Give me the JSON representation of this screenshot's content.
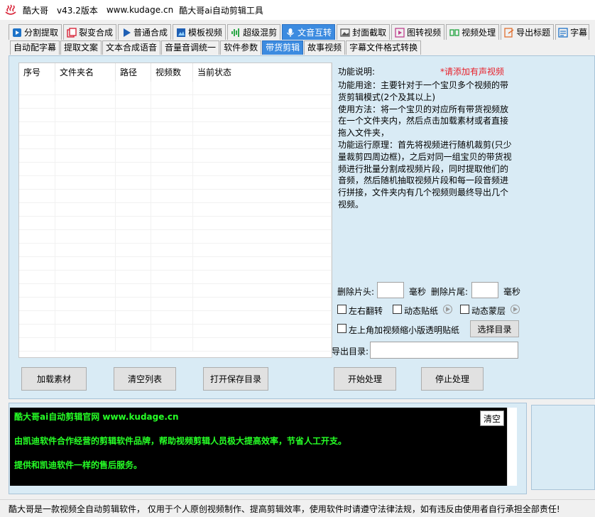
{
  "window": {
    "app_name": "酷大哥",
    "version": "v43.2版本",
    "url": "www.kudage.cn",
    "subtitle": "酷大哥ai自动剪辑工具"
  },
  "main_tabs": [
    {
      "label": "分割提取",
      "icon": "play-square-icon",
      "color": "#1e73c8"
    },
    {
      "label": "裂变合成",
      "icon": "copy-frames-icon",
      "color": "#d9273b"
    },
    {
      "label": "普通合成",
      "icon": "play-triangle-icon",
      "color": "#1e5fb4"
    },
    {
      "label": "模板视频",
      "icon": "template-icon",
      "color": "#1e5fb4"
    },
    {
      "label": "超级混剪",
      "icon": "waveform-icon",
      "color": "#2ea84a"
    },
    {
      "label": "文音互转",
      "icon": "microphone-icon",
      "color": "#ffffff",
      "active": true
    },
    {
      "label": "封面截取",
      "icon": "image-icon",
      "color": "#555555"
    },
    {
      "label": "图转视频",
      "icon": "picture-to-video-icon",
      "color": "#c0408e"
    },
    {
      "label": "视频处理",
      "icon": "video-split-icon",
      "color": "#2ea84a"
    },
    {
      "label": "导出标题",
      "icon": "export-title-icon",
      "color": "#e07030"
    },
    {
      "label": "字幕",
      "icon": "subtitle-icon",
      "color": "#1e73c8"
    }
  ],
  "sub_tabs": [
    {
      "label": "自动配字幕"
    },
    {
      "label": "提取文案"
    },
    {
      "label": "文本合成语音"
    },
    {
      "label": "音量音调统一"
    },
    {
      "label": "软件参数"
    },
    {
      "label": "带货剪辑",
      "active": true
    },
    {
      "label": "故事视频"
    },
    {
      "label": "字幕文件格式转换"
    }
  ],
  "table": {
    "columns": [
      "序号",
      "文件夹名",
      "路径",
      "视频数",
      "当前状态"
    ],
    "rows": []
  },
  "description": {
    "heading": "功能说明:",
    "warning": "*请添加有声视频",
    "text": "功能用途：主要针对于一个宝贝多个视频的带货剪辑模式(2个及其以上)\n使用方法：将一个宝贝的对应所有带货视频放在一个文件夹内，然后点击加载素材或者直接拖入文件夹，\n功能运行原理：首先将视频进行随机裁剪(只少量裁剪四周边框)，之后对同一组宝贝的带货视频进行批量分割成视频片段，同时提取他们的音频，然后随机抽取视频片段和每一段音频进行拼接，文件夹内有几个视频则最终导出几个视频。"
  },
  "options": {
    "delete_head_label": "删除片头:",
    "delete_head_value": "",
    "delete_tail_label": "删除片尾:",
    "delete_tail_value": "",
    "unit_ms": "毫秒",
    "flip_label": "左右翻转",
    "flip_checked": false,
    "sticker_label": "动态贴纸",
    "sticker_checked": false,
    "mask_label": "动态蒙层",
    "mask_checked": false,
    "mini_overlay_label": "左上角加视频缩小版透明贴纸",
    "mini_overlay_checked": false,
    "choose_dir_label": "选择目录",
    "export_dir_label": "导出目录:",
    "export_dir_value": ""
  },
  "buttons": {
    "load": "加载素材",
    "clear_list": "清空列表",
    "open_save_dir": "打开保存目录",
    "start": "开始处理",
    "stop": "停止处理"
  },
  "log": {
    "lines": [
      "酷大哥ai自动剪辑官网  www.kudage.cn",
      "由凯迪软件合作经营的剪辑软件品牌，帮助视频剪辑人员极大提高效率，节省人工开支。",
      "提供和凯迪软件一样的售后服务。"
    ],
    "clear_label": "清空"
  },
  "status_bar": "酷大哥是一款视频全自动剪辑软件，  仅用于个人原创视频制作、提高剪辑效率，使用软件时请遵守法律法规，如有违反由使用者自行承担全部责任!"
}
